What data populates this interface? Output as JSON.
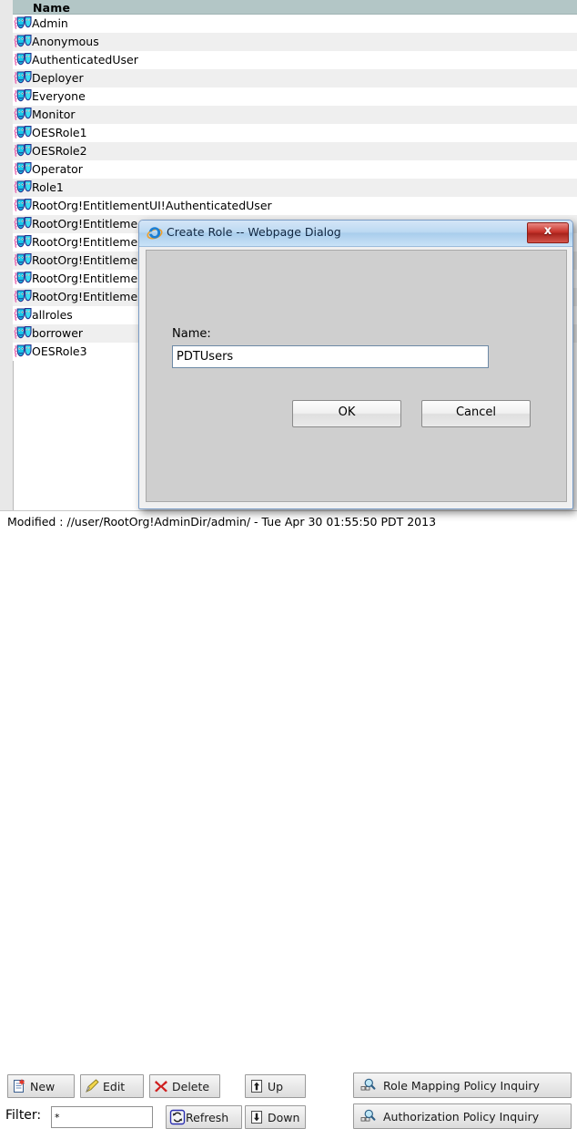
{
  "list": {
    "column_header": "Name",
    "rows": [
      {
        "label": "Admin"
      },
      {
        "label": "Anonymous"
      },
      {
        "label": "AuthenticatedUser"
      },
      {
        "label": "Deployer"
      },
      {
        "label": "Everyone"
      },
      {
        "label": "Monitor"
      },
      {
        "label": "OESRole1"
      },
      {
        "label": "OESRole2"
      },
      {
        "label": "Operator"
      },
      {
        "label": "Role1"
      },
      {
        "label": "RootOrg!EntitlementUI!AuthenticatedUser"
      },
      {
        "label": "RootOrg!Entitleme"
      },
      {
        "label": "RootOrg!Entitleme"
      },
      {
        "label": "RootOrg!Entitleme"
      },
      {
        "label": "RootOrg!Entitleme"
      },
      {
        "label": "RootOrg!Entitleme"
      },
      {
        "label": "allroles"
      },
      {
        "label": "borrower"
      },
      {
        "label": "OESRole3"
      }
    ],
    "row_icon": "role-masks-icon"
  },
  "status": {
    "text": "Modified : //user/RootOrg!AdminDir/admin/ - Tue Apr 30 01:55:50 PDT 2013"
  },
  "toolbar": {
    "new_label": "New",
    "new_icon": "new-document-icon",
    "edit_label": "Edit",
    "edit_icon": "pencil-icon",
    "delete_label": "Delete",
    "delete_icon": "red-x-icon",
    "up_label": "Up",
    "up_icon": "arrow-up-icon",
    "down_label": "Down",
    "down_icon": "arrow-down-icon",
    "refresh_label": "Refresh",
    "refresh_icon": "refresh-icon",
    "role_mapping_label": "Role Mapping Policy Inquiry",
    "role_mapping_icon": "magnifier-icon",
    "authorization_label": "Authorization Policy Inquiry",
    "authorization_icon": "magnifier-icon",
    "filter_label": "Filter:",
    "filter_value": "*"
  },
  "dialog": {
    "title": "Create Role -- Webpage Dialog",
    "title_icon": "internet-explorer-icon",
    "close_glyph": "x",
    "name_label": "Name:",
    "name_value": "PDTUsers",
    "ok_label": "OK",
    "cancel_label": "Cancel"
  },
  "colors": {
    "header_bg": "#b3c6c6",
    "row_alt_bg": "#efefef",
    "dialog_body_bg": "#cfcfcf",
    "close_red": "#c9352c",
    "title_blue": "#bcd9f2"
  }
}
